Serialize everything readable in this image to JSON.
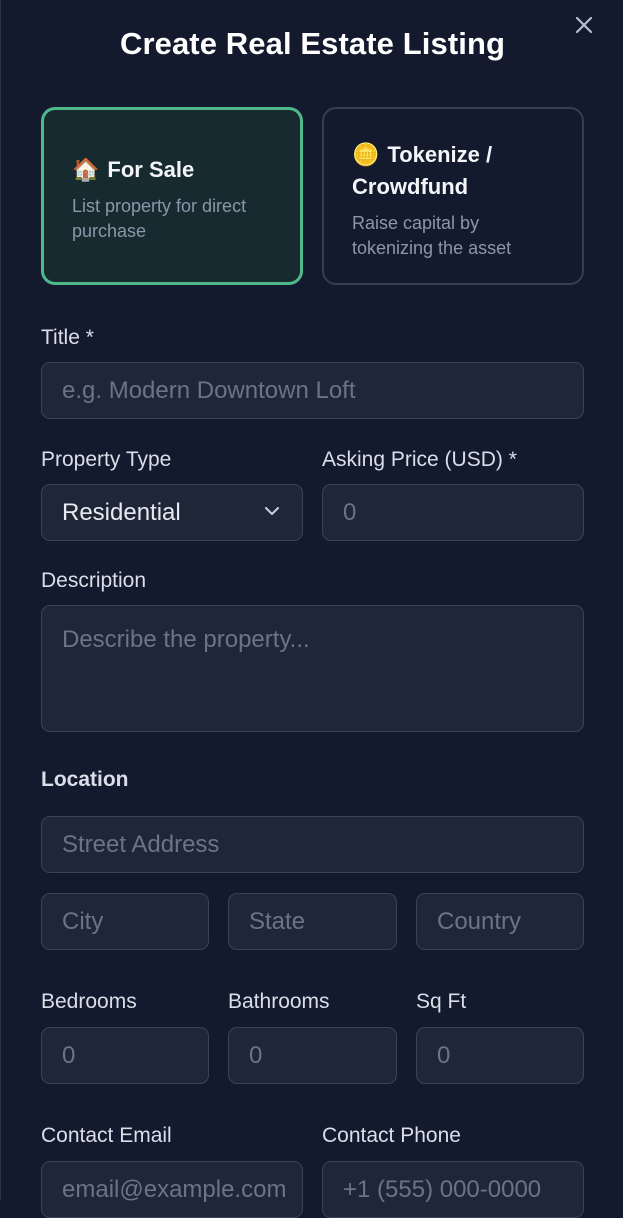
{
  "modal": {
    "title": "Create Real Estate Listing"
  },
  "listing_types": [
    {
      "emoji": "🏠",
      "label": "For Sale",
      "description": "List property for direct purchase",
      "selected": true
    },
    {
      "emoji": "🪙",
      "label": "Tokenize / Crowdfund",
      "description": "Raise capital by tokenizing the asset",
      "selected": false
    }
  ],
  "fields": {
    "title": {
      "label": "Title *",
      "placeholder": "e.g. Modern Downtown Loft"
    },
    "property_type": {
      "label": "Property Type",
      "value": "Residential"
    },
    "asking_price": {
      "label": "Asking Price (USD) *",
      "placeholder": "0"
    },
    "description": {
      "label": "Description",
      "placeholder": "Describe the property..."
    },
    "location": {
      "label": "Location"
    },
    "street": {
      "placeholder": "Street Address"
    },
    "city": {
      "placeholder": "City"
    },
    "state": {
      "placeholder": "State"
    },
    "country": {
      "placeholder": "Country"
    },
    "bedrooms": {
      "label": "Bedrooms",
      "placeholder": "0"
    },
    "bathrooms": {
      "label": "Bathrooms",
      "placeholder": "0"
    },
    "sqft": {
      "label": "Sq Ft",
      "placeholder": "0"
    },
    "contact_email": {
      "label": "Contact Email",
      "placeholder": "email@example.com"
    },
    "contact_phone": {
      "label": "Contact Phone",
      "placeholder": "+1 (555) 000-0000"
    }
  },
  "colors": {
    "background": "#131a2d",
    "input_bg": "#1f2638",
    "selected_border": "#4fb98a"
  }
}
